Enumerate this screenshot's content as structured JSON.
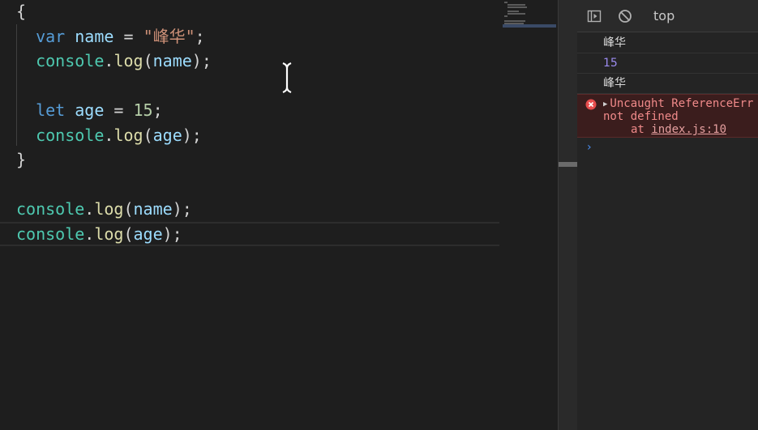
{
  "editor": {
    "lines": [
      [
        {
          "t": "{",
          "c": "punct"
        }
      ],
      [
        {
          "t": "  ",
          "c": "punct"
        },
        {
          "t": "var",
          "c": "kw"
        },
        {
          "t": " ",
          "c": "punct"
        },
        {
          "t": "name",
          "c": "var"
        },
        {
          "t": " = ",
          "c": "op"
        },
        {
          "t": "\"峰华\"",
          "c": "str"
        },
        {
          "t": ";",
          "c": "punct"
        }
      ],
      [
        {
          "t": "  ",
          "c": "punct"
        },
        {
          "t": "console",
          "c": "obj"
        },
        {
          "t": ".",
          "c": "punct"
        },
        {
          "t": "log",
          "c": "fn"
        },
        {
          "t": "(",
          "c": "punct"
        },
        {
          "t": "name",
          "c": "var"
        },
        {
          "t": ");",
          "c": "punct"
        }
      ],
      [],
      [
        {
          "t": "  ",
          "c": "punct"
        },
        {
          "t": "let",
          "c": "kw"
        },
        {
          "t": " ",
          "c": "punct"
        },
        {
          "t": "age",
          "c": "var"
        },
        {
          "t": " = ",
          "c": "op"
        },
        {
          "t": "15",
          "c": "num"
        },
        {
          "t": ";",
          "c": "punct"
        }
      ],
      [
        {
          "t": "  ",
          "c": "punct"
        },
        {
          "t": "console",
          "c": "obj"
        },
        {
          "t": ".",
          "c": "punct"
        },
        {
          "t": "log",
          "c": "fn"
        },
        {
          "t": "(",
          "c": "punct"
        },
        {
          "t": "age",
          "c": "var"
        },
        {
          "t": ");",
          "c": "punct"
        }
      ],
      [
        {
          "t": "}",
          "c": "punct"
        }
      ],
      [],
      [
        {
          "t": "console",
          "c": "obj"
        },
        {
          "t": ".",
          "c": "punct"
        },
        {
          "t": "log",
          "c": "fn"
        },
        {
          "t": "(",
          "c": "punct"
        },
        {
          "t": "name",
          "c": "var"
        },
        {
          "t": ");",
          "c": "punct"
        }
      ],
      [
        {
          "t": "console",
          "c": "obj"
        },
        {
          "t": ".",
          "c": "punct"
        },
        {
          "t": "log",
          "c": "fn"
        },
        {
          "t": "(",
          "c": "punct"
        },
        {
          "t": "age",
          "c": "var"
        },
        {
          "t": ");",
          "c": "punct"
        }
      ]
    ],
    "current_line_index": 9
  },
  "devtools": {
    "context": "top",
    "icons": [
      "sidebar-toggle-icon",
      "clear-console-icon"
    ],
    "messages": {
      "log1": "峰华",
      "log2": "15",
      "log3": "峰华",
      "error_line1": "Uncaught ReferenceErr",
      "error_line2": "not defined",
      "error_at": "at ",
      "error_link": "index.js:10"
    },
    "prompt": "›"
  },
  "colors": {
    "editor_bg": "#1e1e1e",
    "keyword": "#569cd6",
    "variable": "#9cdcfe",
    "object": "#4ec9b0",
    "function": "#dcdcaa",
    "string": "#ce9178",
    "number": "#b5cea8",
    "error_bg": "#3b1d1d",
    "error_text": "#f08a8a",
    "number_log": "#9c8cf0"
  }
}
